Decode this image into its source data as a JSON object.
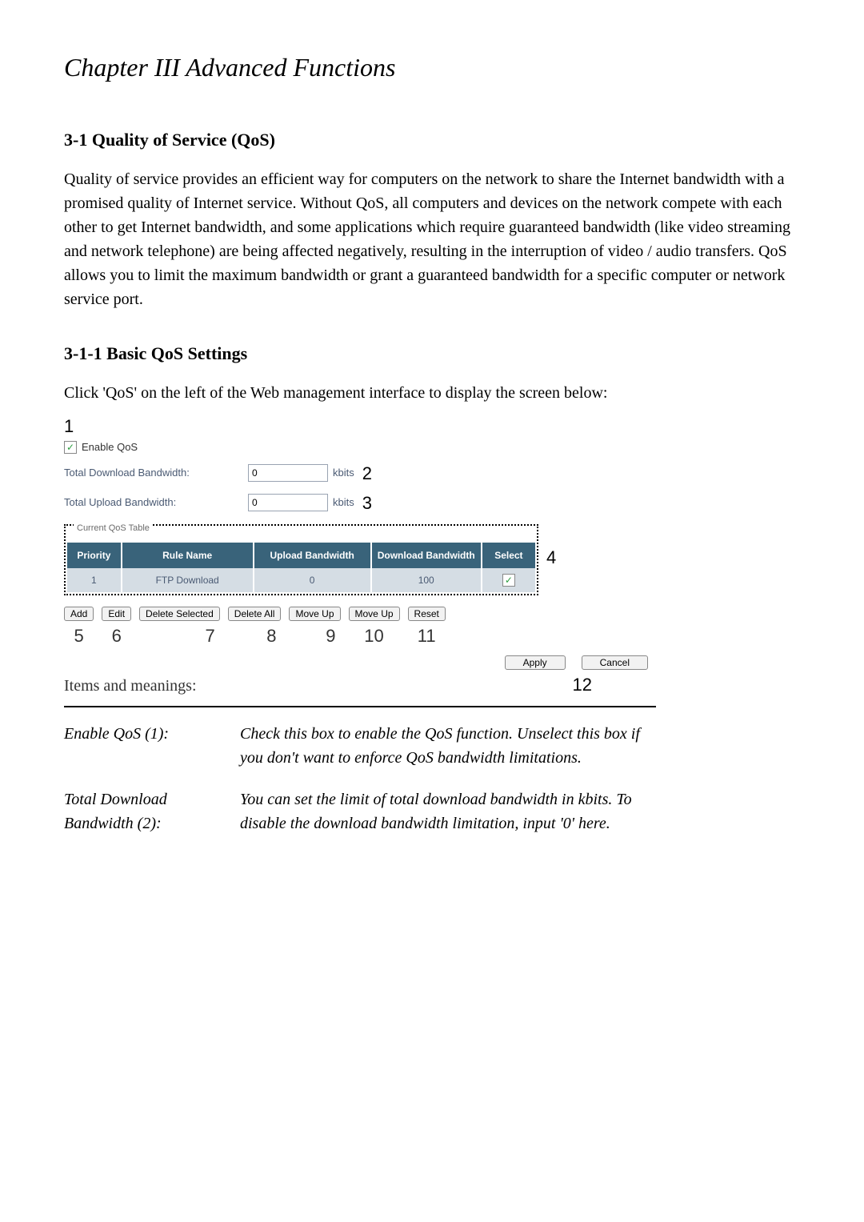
{
  "chapter_title": "Chapter III    Advanced Functions",
  "section_1_title": "3-1 Quality of Service (QoS)",
  "section_1_body": "Quality of service provides an efficient way for computers on the network to share the Internet bandwidth with a promised quality of Internet service. Without QoS, all computers and devices on the network compete with each other to get Internet bandwidth, and some applications which require guaranteed bandwidth (like video streaming and network telephone) are being affected negatively, resulting in the interruption of video / audio transfers. QoS allows you to limit the maximum bandwidth or grant a guaranteed bandwidth for a specific computer or network service port.",
  "section_1_1_title": "3-1-1 Basic QoS Settings",
  "section_1_1_body": "Click 'QoS' on the left of the Web management interface to display the screen below:",
  "annot": {
    "num1": "1",
    "num2": "2",
    "num3": "3",
    "num4": "4",
    "num5": "5",
    "num6": "6",
    "num7": "7",
    "num8": "8",
    "num9": "9",
    "num10": "10",
    "num11": "11",
    "num12": "12"
  },
  "ui": {
    "check_symbol": "✓",
    "enable_label": "Enable QoS",
    "down_bw_label": "Total Download Bandwidth:",
    "down_bw_value": "0",
    "down_bw_unit": "kbits",
    "up_bw_label": "Total Upload Bandwidth:",
    "up_bw_value": "0",
    "up_bw_unit": "kbits",
    "table_legend": "Current QoS Table",
    "th_priority": "Priority",
    "th_rule": "Rule Name",
    "th_up": "Upload Bandwidth",
    "th_down": "Download Bandwidth",
    "th_select": "Select",
    "row1": {
      "priority": "1",
      "rule": "FTP Download",
      "up": "0",
      "down": "100"
    },
    "btn_add": "Add",
    "btn_edit": "Edit",
    "btn_delete_selected": "Delete Selected",
    "btn_delete_all": "Delete All",
    "btn_move_up": "Move Up",
    "btn_move_up2": "Move Up",
    "btn_reset": "Reset",
    "btn_apply": "Apply",
    "btn_cancel": "Cancel"
  },
  "items_label": "Items and meanings:",
  "defs": {
    "t1": "Enable QoS (1):",
    "d1": "Check this box to enable the QoS function. Unselect this box if you don't want to enforce QoS bandwidth limitations.",
    "t2a": "Total Download",
    "t2b": "Bandwidth (2):",
    "d2": "You can set the limit of total download bandwidth in kbits. To disable the download bandwidth limitation, input '0' here."
  }
}
